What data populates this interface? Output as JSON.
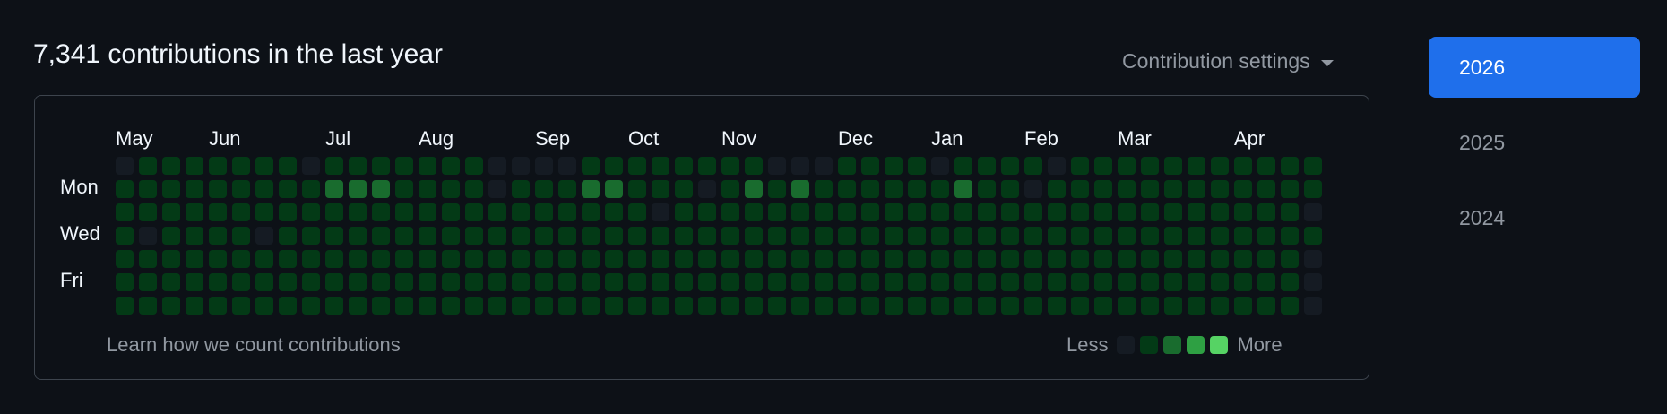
{
  "header": {
    "title": "7,341 contributions in the last year",
    "settings_label": "Contribution settings"
  },
  "months": [
    "May",
    "Jun",
    "Jul",
    "Aug",
    "Sep",
    "Oct",
    "Nov",
    "Dec",
    "Jan",
    "Feb",
    "Mar",
    "Apr"
  ],
  "month_start_week": [
    0,
    4,
    9,
    13,
    18,
    22,
    26,
    31,
    35,
    39,
    43,
    48
  ],
  "day_labels": [
    "Mon",
    "Wed",
    "Fri"
  ],
  "footer": {
    "learn_link": "Learn how we count contributions",
    "legend_less": "Less",
    "legend_more": "More"
  },
  "levels": [
    "#151b23",
    "#033a16",
    "#196c2e",
    "#2ea043",
    "#56d364"
  ],
  "contribution_levels": [
    "0111111101111111000011111111000111101111011111111111",
    "1111111112221111011122111012121111112110111111111111",
    "1111111111111111111111101111111111111111111111111110",
    "1011110111111111111111111111111111111111111111111111",
    "1111111111111111111111111111111111111111111111111110",
    "1111111111111111111111111111111111111111111111111110",
    "1111111111111111111111111111111111111111111111111110"
  ],
  "years": {
    "items": [
      "2026",
      "2025",
      "2024"
    ],
    "selected": "2026"
  }
}
